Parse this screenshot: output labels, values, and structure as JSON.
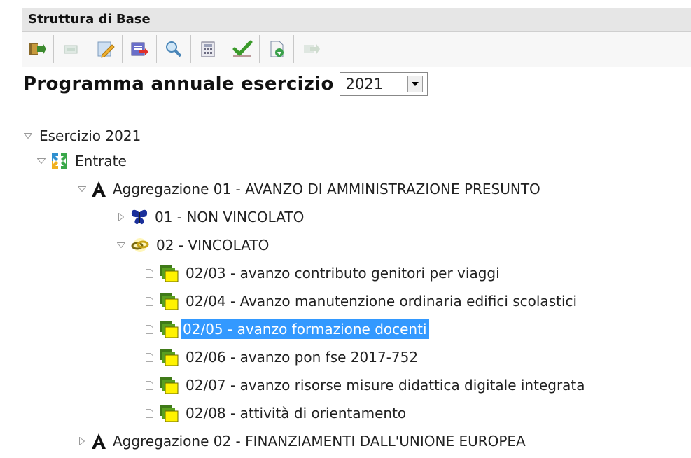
{
  "panel_title": "Struttura di Base",
  "toolbar": {
    "buttons": [
      "exit-icon",
      "new-icon",
      "edit-icon",
      "transfer-icon",
      "search-icon",
      "calculator-icon",
      "approve-icon",
      "document-icon",
      "disabled-transfer-icon"
    ]
  },
  "heading": "Programma annuale esercizio",
  "year_select": {
    "value": "2021"
  },
  "tree": {
    "root": "Esercizio 2021",
    "entrate": "Entrate",
    "agg01": "Aggregazione 01 - AVANZO DI AMMINISTRAZIONE PRESUNTO",
    "nv": "01 - NON VINCOLATO",
    "v": "02 - VINCOLATO",
    "items": [
      "02/03 - avanzo contributo genitori per viaggi",
      "02/04 - Avanzo manutenzione ordinaria edifici scolastici",
      "02/05 - avanzo formazione docenti",
      "02/06 - avanzo pon fse 2017-752",
      "02/07 - avanzo risorse misure didattica digitale integrata",
      "02/08 - attività di orientamento"
    ],
    "agg02": "Aggregazione 02 - FINANZIAMENTI DALL'UNIONE EUROPEA"
  },
  "colors": {
    "selection": "#3399ff",
    "titlebar": "#e6e6e6"
  }
}
